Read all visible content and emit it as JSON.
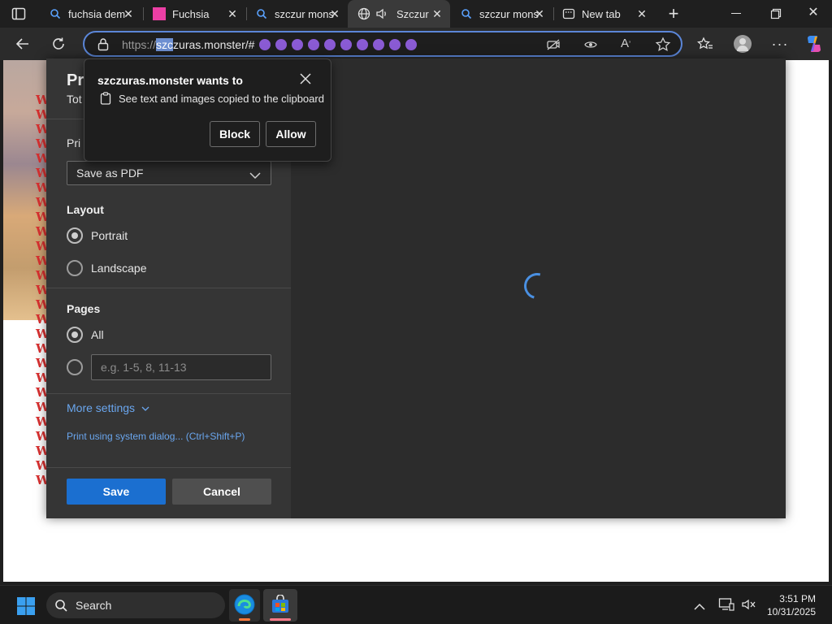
{
  "tabs": [
    {
      "title": "fuchsia dem",
      "icon": "search-icon",
      "active": false
    },
    {
      "title": "Fuchsia",
      "icon": "fuchsia-square-icon",
      "active": false
    },
    {
      "title": "szczur mons",
      "icon": "search-icon",
      "active": false
    },
    {
      "title": "Szczura",
      "icon": "globe-icon",
      "active": true
    },
    {
      "title": "szczur mons",
      "icon": "search-icon",
      "active": false
    },
    {
      "title": "New tab",
      "icon": "newtab-icon",
      "active": false
    }
  ],
  "address": {
    "scheme": "https://",
    "selected": "szc",
    "rest": "zuras.monster/#",
    "emoji_count": 10
  },
  "print_dialog": {
    "title_partial": "Pr",
    "total_partial": "Tot",
    "printer_partial": "Pri",
    "destination": "Save as PDF",
    "layout_heading": "Layout",
    "portrait_label": "Portrait",
    "landscape_label": "Landscape",
    "orientation_selected": "Portrait",
    "pages_heading": "Pages",
    "pages_all_label": "All",
    "pages_placeholder": "e.g. 1-5, 8, 11-13",
    "more_settings": "More settings",
    "system_dialog": "Print using system dialog... (Ctrl+Shift+P)",
    "save_label": "Save",
    "cancel_label": "Cancel"
  },
  "permission_popup": {
    "title": "szczuras.monster wants to",
    "description": "See text and images copied to the clipboard",
    "block_label": "Block",
    "allow_label": "Allow"
  },
  "page_letters": "W",
  "taskbar": {
    "search_label": "Search",
    "time": "3:51 PM",
    "date": "10/31/2025"
  },
  "colors": {
    "accent": "#1b6fd0",
    "address_border": "#5b86d8",
    "emoji_purple": "#8a5bd4",
    "fuchsia": "#ec3fa5"
  }
}
